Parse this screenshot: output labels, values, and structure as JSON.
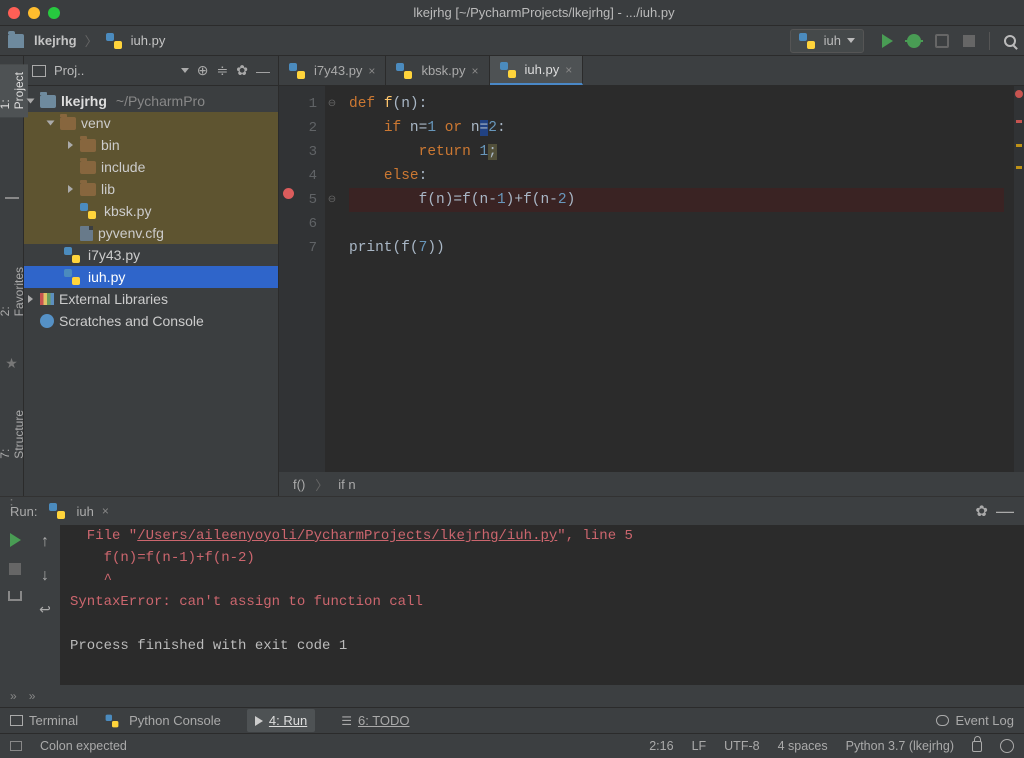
{
  "window": {
    "title": "lkejrhg [~/PycharmProjects/lkejrhg] - .../iuh.py"
  },
  "breadcrumbs": {
    "project": "lkejrhg",
    "file": "iuh.py"
  },
  "run_config": {
    "label": "iuh"
  },
  "project_panel": {
    "title": "Proj..",
    "root": "lkejrhg",
    "root_path": "~/PycharmPro",
    "venv": "venv",
    "venv_children": {
      "bin": "bin",
      "include": "include",
      "lib": "lib",
      "kbsk": "kbsk.py",
      "pyvenv": "pyvenv.cfg"
    },
    "i7y43": "i7y43.py",
    "iuh": "iuh.py",
    "ext_libs": "External Libraries",
    "scratches": "Scratches and Console"
  },
  "tabs": {
    "t1": "i7y43.py",
    "t2": "kbsk.py",
    "t3": "iuh.py"
  },
  "code": {
    "l1_def": "def ",
    "l1_f": "f",
    "l1_paren": "(n):",
    "l2_if": "if ",
    "l2_n1": "n",
    "l2_eq1": "=",
    "l2_one": "1",
    "l2_or": " or ",
    "l2_n2": "n",
    "l2_eq2": "=",
    "l2_two": "2",
    "l2_colon": ":",
    "l3_return": "return ",
    "l3_one": "1",
    "l3_semi": ";",
    "l4_else": "else",
    "l4_colon": ":",
    "l5_a": "f",
    "l5_b": "(n)=",
    "l5_c": "f",
    "l5_d": "(n-",
    "l5_one": "1",
    "l5_e": ")+",
    "l5_f": "f",
    "l5_g": "(n-",
    "l5_two": "2",
    "l5_h": ")",
    "l7_print": "print",
    "l7_a": "(f(",
    "l7_seven": "7",
    "l7_b": "))"
  },
  "editor_crumbs": {
    "a": "f()",
    "b": "if n"
  },
  "run": {
    "label": "Run:",
    "config": "iuh",
    "file_prefix": "  File \"",
    "file_path": "/Users/aileenyoyoli/PycharmProjects/lkejrhg/iuh.py",
    "file_suffix": "\", line 5",
    "line2": "    f(n)=f(n-1)+f(n-2)",
    "line3": "    ^",
    "error": "SyntaxError: can't assign to function call",
    "exit": "Process finished with exit code 1"
  },
  "bottom_tabs": {
    "terminal": "Terminal",
    "pyconsole": "Python Console",
    "run": "4: Run",
    "todo": "6: TODO",
    "eventlog": "Event Log"
  },
  "left_rail": {
    "project": "1: Project",
    "favorites": "2: Favorites",
    "structure": "7: Structure"
  },
  "status": {
    "msg": "Colon expected",
    "pos": "2:16",
    "le": "LF",
    "enc": "UTF-8",
    "indent": "4 spaces",
    "interp": "Python 3.7 (lkejrhg)"
  }
}
